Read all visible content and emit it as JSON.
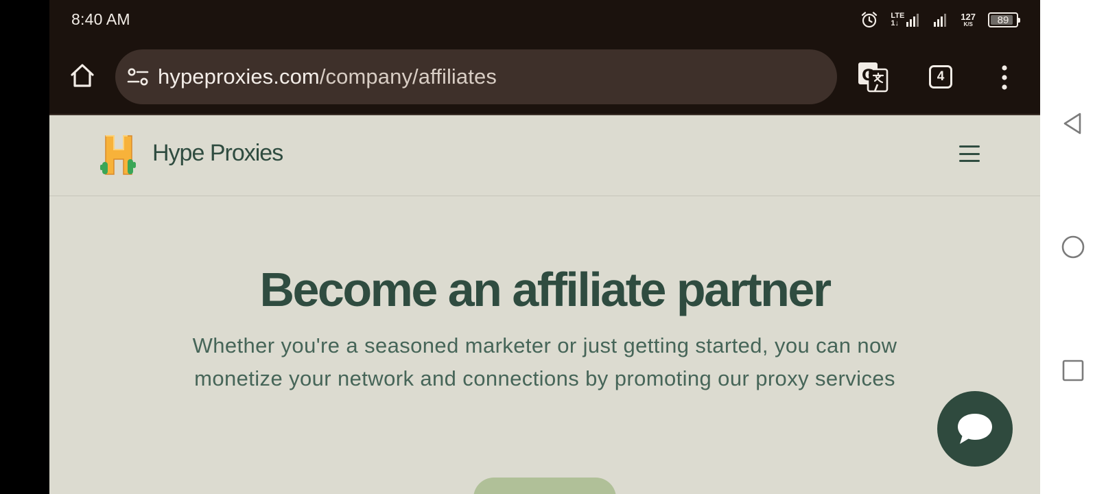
{
  "status_bar": {
    "time": "8:40 AM",
    "network_type": "LTE",
    "network_sub": "1↓",
    "speed_value": "127",
    "speed_unit": "K/S",
    "battery": "89",
    "battery_level": 0.89
  },
  "browser": {
    "url_domain": "hypeproxies.com",
    "url_path": "/company/affiliates",
    "tab_count": "4",
    "icons": {
      "home": "home-icon",
      "site_info": "site-settings-icon",
      "translate": "translate-icon",
      "menu": "more-vert-icon"
    }
  },
  "site": {
    "brand": "Hype Proxies",
    "colors": {
      "primary": "#2f4c40",
      "background": "#dcdbd0",
      "cta": "#b0c098",
      "logo": "#f7b23a",
      "cactus": "#3aa657"
    }
  },
  "hero": {
    "title": "Become an affiliate partner",
    "subtitle": "Whether you're a seasoned marketer or just getting started, you can now monetize your network and connections by promoting our proxy services"
  },
  "system_nav": {
    "back": "back-icon",
    "home": "home-circle-icon",
    "recents": "recents-icon"
  }
}
